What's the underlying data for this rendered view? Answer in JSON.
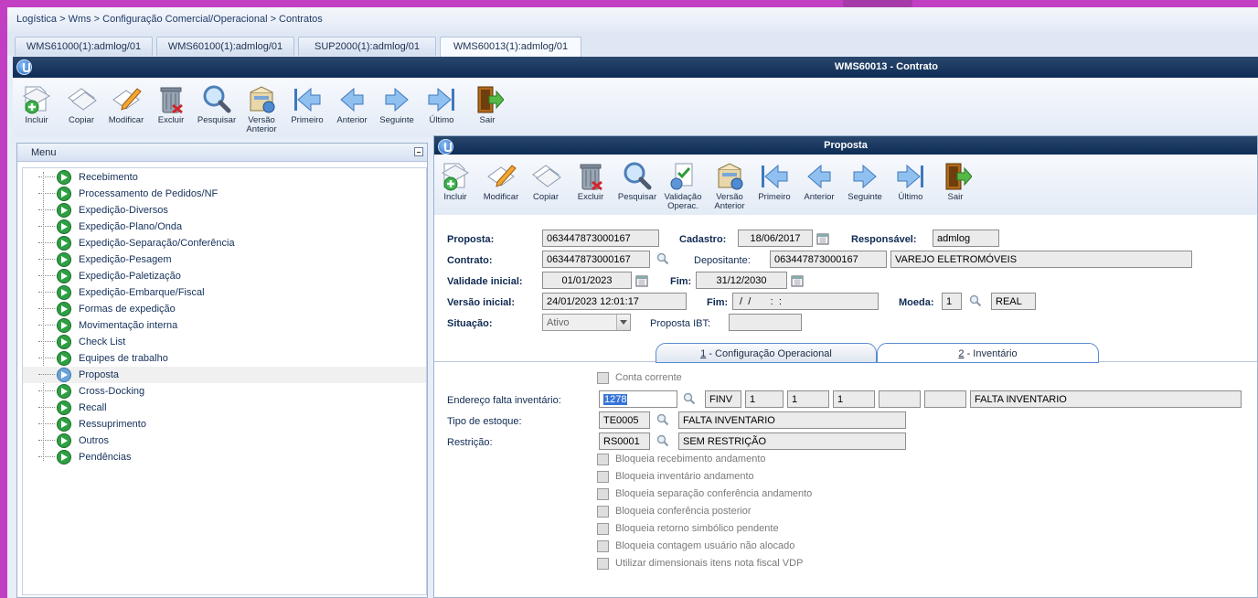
{
  "breadcrumb": "Logística > Wms > Configuração Comercial/Operacional > Contratos",
  "tabs": [
    {
      "label": "WMS61000(1):admlog/01"
    },
    {
      "label": "WMS60100(1):admlog/01"
    },
    {
      "label": "SUP2000(1):admlog/01"
    },
    {
      "label": "WMS60013(1):admlog/01"
    }
  ],
  "window_title": "WMS60013 - Contrato",
  "main_toolbar": [
    {
      "label": "Incluir",
      "icon": "add-document-icon"
    },
    {
      "label": "Copiar",
      "icon": "copy-icon"
    },
    {
      "label": "Modificar",
      "icon": "edit-pencil-icon"
    },
    {
      "label": "Excluir",
      "icon": "trash-icon"
    },
    {
      "label": "Pesquisar",
      "icon": "magnifier-icon"
    },
    {
      "label": "Versão Anterior",
      "icon": "previous-version-icon"
    },
    {
      "label": "Primeiro",
      "icon": "first-arrow-icon"
    },
    {
      "label": "Anterior",
      "icon": "previous-arrow-icon"
    },
    {
      "label": "Seguinte",
      "icon": "next-arrow-icon"
    },
    {
      "label": "Último",
      "icon": "last-arrow-icon"
    },
    {
      "label": "Sair",
      "icon": "exit-door-icon"
    }
  ],
  "menu": {
    "title": "Menu",
    "items": [
      {
        "label": "Recebimento"
      },
      {
        "label": "Processamento de Pedidos/NF"
      },
      {
        "label": "Expedição-Diversos"
      },
      {
        "label": "Expedição-Plano/Onda"
      },
      {
        "label": "Expedição-Separação/Conferência"
      },
      {
        "label": "Expedição-Pesagem"
      },
      {
        "label": "Expedição-Paletização"
      },
      {
        "label": "Expedição-Embarque/Fiscal"
      },
      {
        "label": "Formas de expedição"
      },
      {
        "label": "Movimentação interna"
      },
      {
        "label": "Check List"
      },
      {
        "label": "Equipes de trabalho"
      },
      {
        "label": "Proposta",
        "selected": true
      },
      {
        "label": "Cross-Docking"
      },
      {
        "label": "Recall"
      },
      {
        "label": "Ressuprimento"
      },
      {
        "label": "Outros"
      },
      {
        "label": "Pendências"
      }
    ]
  },
  "form": {
    "title": "Proposta",
    "toolbar": [
      {
        "label": "Incluir",
        "icon": "add-document-icon"
      },
      {
        "label": "Modificar",
        "icon": "edit-pencil-icon"
      },
      {
        "label": "Copiar",
        "icon": "copy-icon"
      },
      {
        "label": "Excluir",
        "icon": "trash-icon"
      },
      {
        "label": "Pesquisar",
        "icon": "magnifier-icon"
      },
      {
        "label": "Validação Operac.",
        "icon": "validation-icon"
      },
      {
        "label": "Versão Anterior",
        "icon": "previous-version-icon"
      },
      {
        "label": "Primeiro",
        "icon": "first-arrow-icon"
      },
      {
        "label": "Anterior",
        "icon": "previous-arrow-icon"
      },
      {
        "label": "Seguinte",
        "icon": "next-arrow-icon"
      },
      {
        "label": "Último",
        "icon": "last-arrow-icon"
      },
      {
        "label": "Sair",
        "icon": "exit-door-icon"
      }
    ],
    "proposta_label": "Proposta:",
    "proposta": "063447873000167",
    "cadastro_label": "Cadastro:",
    "cadastro": "18/06/2017",
    "responsavel_label": "Responsável:",
    "responsavel": "admlog",
    "contrato_label": "Contrato:",
    "contrato": "063447873000167",
    "depositante_label": "Depositante:",
    "depositante_code": "063447873000167",
    "depositante_name": "VAREJO ELETROMÓVEIS",
    "validade_label": "Validade inicial:",
    "validade": "01/01/2023",
    "fim_label": "Fim:",
    "fim": "31/12/2030",
    "versao_label": "Versão inicial:",
    "versao": "24/01/2023 12:01:17",
    "fim2_label": "Fim:",
    "fim2": " /  /       :  :",
    "moeda_label": "Moeda:",
    "moeda_code": "1",
    "moeda_name": "REAL",
    "situacao_label": "Situação:",
    "situacao": "Ativo",
    "proposta_ibt_label": "Proposta IBT:",
    "proposta_ibt": "",
    "tab1_num": "1",
    "tab1_text": " - Configuração Operacional",
    "tab2_num": "2",
    "tab2_text": " - Inventário",
    "conta_corrente": "Conta corrente",
    "endereco_label": "Endereço falta inventário:",
    "endereco_code": "1278",
    "endereco_parts": [
      "FINV",
      "1",
      "1",
      "1",
      "",
      ""
    ],
    "endereco_desc": "FALTA INVENTARIO",
    "tipo_label": "Tipo de estoque:",
    "tipo_code": "TE0005",
    "tipo_desc": "FALTA INVENTARIO",
    "restricao_label": "Restrição:",
    "restricao_code": "RS0001",
    "restricao_desc": "SEM RESTRIÇÃO",
    "checks": [
      "Bloqueia recebimento andamento",
      "Bloqueia inventário andamento",
      "Bloqueia separação conferência andamento",
      "Bloqueia conferência posterior",
      "Bloqueia retorno simbólico pendente",
      "Bloqueia contagem usuário não alocado",
      "Utilizar dimensionais itens nota fiscal VDP"
    ]
  }
}
